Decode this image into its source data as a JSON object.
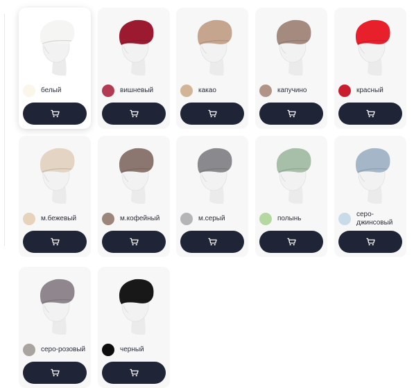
{
  "products": [
    {
      "color_name": "белый",
      "hat_color": "#f5f5f3",
      "swatch_color": "#fbf6ea",
      "selected": true
    },
    {
      "color_name": "вишневый",
      "hat_color": "#9c1a30",
      "swatch_color": "#b23a52"
    },
    {
      "color_name": "какао",
      "hat_color": "#c6a58f",
      "swatch_color": "#d2b597"
    },
    {
      "color_name": "капучино",
      "hat_color": "#a58a80",
      "swatch_color": "#b09488"
    },
    {
      "color_name": "красный",
      "hat_color": "#e8202b",
      "swatch_color": "#c81e2e"
    },
    {
      "color_name": "м.бежевый",
      "hat_color": "#e4d4c3",
      "swatch_color": "#e7d2bb"
    },
    {
      "color_name": "м.кофейный",
      "hat_color": "#8c7670",
      "swatch_color": "#9c857a"
    },
    {
      "color_name": "м.серый",
      "hat_color": "#8a8a8e",
      "swatch_color": "#b5b5b8"
    },
    {
      "color_name": "полынь",
      "hat_color": "#a7bea8",
      "swatch_color": "#b6d7a1"
    },
    {
      "color_name": "серо-джинсовый",
      "hat_color": "#a4b6c8",
      "swatch_color": "#c9dbe8"
    },
    {
      "color_name": "серо-розовый",
      "hat_color": "#8f868e",
      "swatch_color": "#a9a4a0"
    },
    {
      "color_name": "черный",
      "hat_color": "#181818",
      "swatch_color": "#0d0d0d"
    }
  ],
  "icons": {
    "cart": "shopping-cart-icon"
  },
  "colors": {
    "button_bg": "#1f2436",
    "card_bg": "#f7f7f8",
    "text": "#2b2f3a"
  }
}
